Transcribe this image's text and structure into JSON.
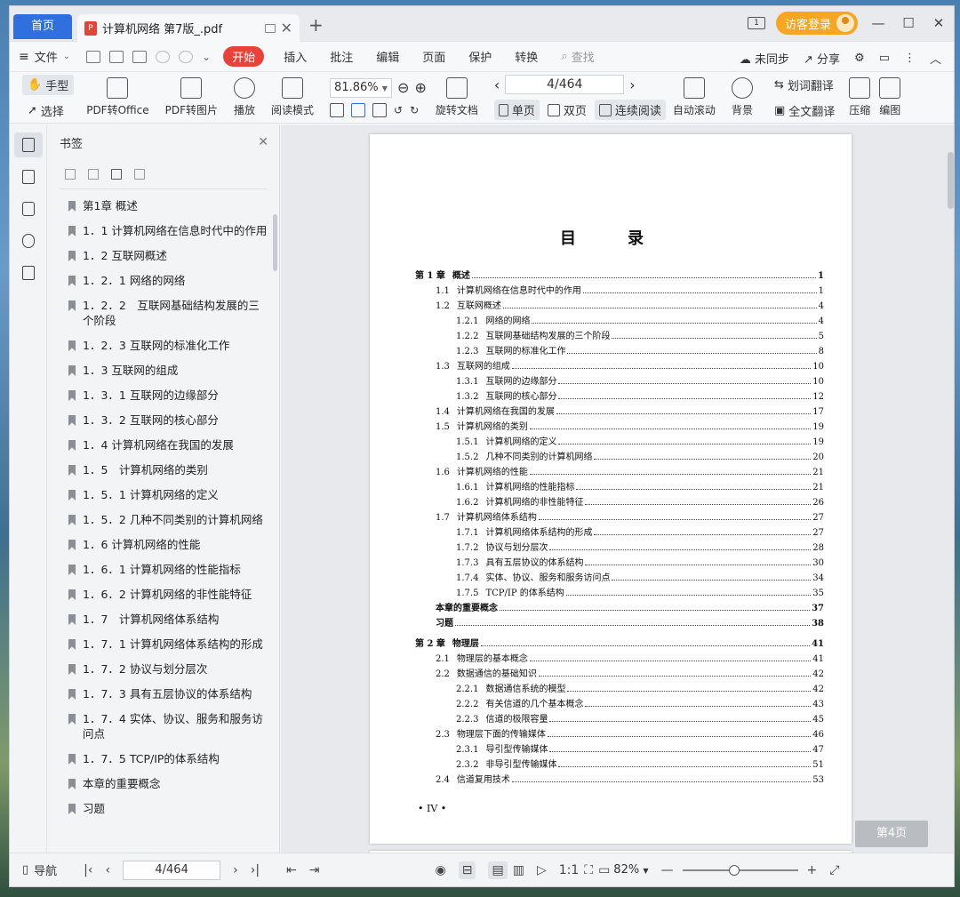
{
  "tabs": {
    "home": "首页",
    "doc_title": "计算机网络 第7版_.pdf",
    "new_tab": "+"
  },
  "titlebar": {
    "login": "访客登录",
    "minimize": "—",
    "maximize": "☐",
    "close": "✕"
  },
  "menu": {
    "file": "文件",
    "start": "开始",
    "items": [
      "插入",
      "批注",
      "编辑",
      "页面",
      "保护",
      "转换"
    ],
    "search_placeholder": "查找",
    "unsync": "未同步",
    "share": "分享"
  },
  "ribbon": {
    "hand": "手型",
    "select": "选择",
    "pdf_to_office": "PDF转Office",
    "pdf_to_image": "PDF转图片",
    "play": "播放",
    "read_mode": "阅读模式",
    "zoom": "81.86%",
    "page": "4/464",
    "rotate": "旋转文档",
    "single": "单页",
    "double": "双页",
    "continuous": "连续阅读",
    "auto_scroll": "自动滚动",
    "background": "背景",
    "word_translate": "划词翻译",
    "full_translate": "全文翻译",
    "compress": "压缩",
    "edit_image": "编图"
  },
  "bookmarks": {
    "title": "书签",
    "items": [
      "第1章 概述",
      "1．1 计算机网络在信息时代中的作用",
      "1．2 互联网概述",
      "1．2．1 网络的网络",
      "1．2．2　互联网基础结构发展的三个阶段",
      "1．2．3 互联网的标准化工作",
      "1．3 互联网的组成",
      "1．3．1 互联网的边缘部分",
      "1．3．2 互联网的核心部分",
      "1．4 计算机网络在我国的发展",
      "1．5　计算机网络的类别",
      "1．5．1 计算机网络的定义",
      "1．5．2 几种不同类别的计算机网络",
      "1．6 计算机网络的性能",
      "1．6．1 计算机网络的性能指标",
      "1．6．2 计算机网络的非性能特征",
      "1．7　计算机网络体系结构",
      "1．7．1 计算机网络体系结构的形成",
      "1．7．2 协议与划分层次",
      "1．7．3 具有五层协议的体系结构",
      "1．7．4 实体、协议、服务和服务访问点",
      "1．7．5 TCP/IP的体系结构",
      "本章的重要概念",
      "习题"
    ]
  },
  "toc": {
    "title": "目　录",
    "rows": [
      {
        "level": 0,
        "num": "第 1 章",
        "text": "概述",
        "page": "1"
      },
      {
        "level": 1,
        "num": "1.1",
        "text": "计算机网络在信息时代中的作用",
        "page": "1"
      },
      {
        "level": 1,
        "num": "1.2",
        "text": "互联网概述",
        "page": "4"
      },
      {
        "level": 2,
        "num": "1.2.1",
        "text": "网络的网络",
        "page": "4"
      },
      {
        "level": 2,
        "num": "1.2.2",
        "text": "互联网基础结构发展的三个阶段",
        "page": "5"
      },
      {
        "level": 2,
        "num": "1.2.3",
        "text": "互联网的标准化工作",
        "page": "8"
      },
      {
        "level": 1,
        "num": "1.3",
        "text": "互联网的组成",
        "page": "10"
      },
      {
        "level": 2,
        "num": "1.3.1",
        "text": "互联网的边缘部分",
        "page": "10"
      },
      {
        "level": 2,
        "num": "1.3.2",
        "text": "互联网的核心部分",
        "page": "12"
      },
      {
        "level": 1,
        "num": "1.4",
        "text": "计算机网络在我国的发展",
        "page": "17"
      },
      {
        "level": 1,
        "num": "1.5",
        "text": "计算机网络的类别",
        "page": "19"
      },
      {
        "level": 2,
        "num": "1.5.1",
        "text": "计算机网络的定义",
        "page": "19"
      },
      {
        "level": 2,
        "num": "1.5.2",
        "text": "几种不同类别的计算机网络",
        "page": "20"
      },
      {
        "level": 1,
        "num": "1.6",
        "text": "计算机网络的性能",
        "page": "21"
      },
      {
        "level": 2,
        "num": "1.6.1",
        "text": "计算机网络的性能指标",
        "page": "21"
      },
      {
        "level": 2,
        "num": "1.6.2",
        "text": "计算机网络的非性能特征",
        "page": "26"
      },
      {
        "level": 1,
        "num": "1.7",
        "text": "计算机网络体系结构",
        "page": "27"
      },
      {
        "level": 2,
        "num": "1.7.1",
        "text": "计算机网络体系结构的形成",
        "page": "27"
      },
      {
        "level": 2,
        "num": "1.7.2",
        "text": "协议与划分层次",
        "page": "28"
      },
      {
        "level": 2,
        "num": "1.7.3",
        "text": "具有五层协议的体系结构",
        "page": "30"
      },
      {
        "level": 2,
        "num": "1.7.4",
        "text": "实体、协议、服务和服务访问点",
        "page": "34"
      },
      {
        "level": 2,
        "num": "1.7.5",
        "text": "TCP/IP 的体系结构",
        "page": "35"
      },
      {
        "level": 1,
        "num": "",
        "text": "本章的重要概念",
        "page": "37",
        "bold": true
      },
      {
        "level": 1,
        "num": "",
        "text": "习题",
        "page": "38",
        "bold": true
      },
      {
        "level": 0,
        "num": "第 2 章",
        "text": "物理层",
        "page": "41",
        "gap": true
      },
      {
        "level": 1,
        "num": "2.1",
        "text": "物理层的基本概念",
        "page": "41"
      },
      {
        "level": 1,
        "num": "2.2",
        "text": "数据通信的基础知识",
        "page": "42"
      },
      {
        "level": 2,
        "num": "2.2.1",
        "text": "数据通信系统的模型",
        "page": "42"
      },
      {
        "level": 2,
        "num": "2.2.2",
        "text": "有关信道的几个基本概念",
        "page": "43"
      },
      {
        "level": 2,
        "num": "2.2.3",
        "text": "信道的极限容量",
        "page": "45"
      },
      {
        "level": 1,
        "num": "2.3",
        "text": "物理层下面的传输媒体",
        "page": "46"
      },
      {
        "level": 2,
        "num": "2.3.1",
        "text": "导引型传输媒体",
        "page": "47"
      },
      {
        "level": 2,
        "num": "2.3.2",
        "text": "非导引型传输媒体",
        "page": "51"
      },
      {
        "level": 1,
        "num": "2.4",
        "text": "信道复用技术",
        "page": "53"
      }
    ],
    "footer": "• IV •"
  },
  "page_badge": "第4页",
  "status": {
    "nav": "导航",
    "page": "4/464",
    "zoom": "82%"
  }
}
